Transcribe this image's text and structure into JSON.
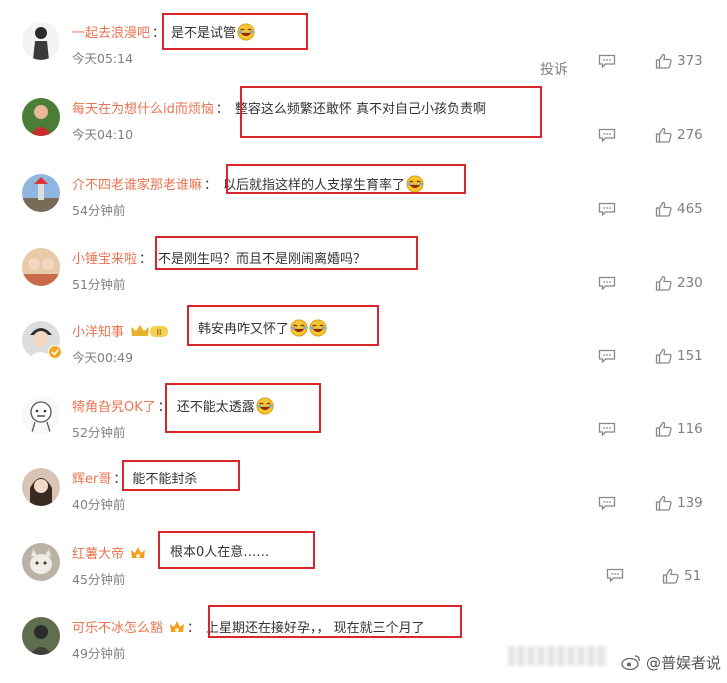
{
  "report_label": "投诉",
  "watermark": "@普娱者说",
  "accent": "#eb7350",
  "highlight": "#d9262c",
  "comments": [
    {
      "user": "一起去浪漫吧",
      "colon": "：",
      "text": "是不是试管",
      "emoji": 2,
      "time": "今天05:14",
      "likes": "373"
    },
    {
      "user": "每天在为想什么id而烦恼",
      "colon": "：",
      "text": "整容这么频繁还敢怀 真不对自己小孩负责啊",
      "emoji": 0,
      "time": "今天04:10",
      "likes": "276"
    },
    {
      "user": "介不四老谁家那老谁嘛",
      "colon": "：",
      "text": "以后就指这样的人支撑生育率了",
      "emoji": 1,
      "time": "54分钟前",
      "likes": "465"
    },
    {
      "user": "小锤宝来啦",
      "colon": "：",
      "text": "不是刚生吗？而且不是刚闹离婚吗？",
      "emoji": 0,
      "time": "51分钟前",
      "likes": "230"
    },
    {
      "user": "小洋知事",
      "colon": "：",
      "text": "韩安冉咋又怀了",
      "emoji": 2,
      "time": "今天00:49",
      "likes": "151"
    },
    {
      "user": "犄角旮旯OK了",
      "colon": "：",
      "text": "还不能太透露",
      "emoji": 1,
      "time": "52分钟前",
      "likes": "116"
    },
    {
      "user": "辉er哥",
      "colon": "：",
      "text": "能不能封杀",
      "emoji": 0,
      "time": "40分钟前",
      "likes": "139"
    },
    {
      "user": "红薯大帝",
      "colon": "：",
      "text": "根本0人在意……",
      "emoji": 0,
      "time": "45分钟前",
      "likes": "51"
    },
    {
      "user": "可乐不冰怎么豁",
      "colon": "：",
      "text": "上星期还在接好孕，， 现在就三个月了",
      "emoji": 0,
      "time": "49分钟前",
      "likes": ""
    }
  ]
}
